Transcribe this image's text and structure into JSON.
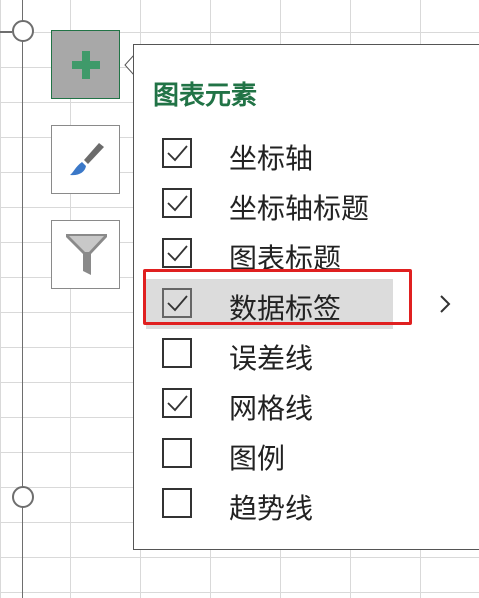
{
  "panel": {
    "title": "图表元素",
    "items": [
      {
        "label": "坐标轴",
        "checked": true
      },
      {
        "label": "坐标轴标题",
        "checked": true
      },
      {
        "label": "图表标题",
        "checked": true
      },
      {
        "label": "数据标签",
        "checked": true,
        "hovered": true,
        "has_submenu": true
      },
      {
        "label": "误差线",
        "checked": false
      },
      {
        "label": "网格线",
        "checked": true
      },
      {
        "label": "图例",
        "checked": false
      },
      {
        "label": "趋势线",
        "checked": false
      }
    ]
  },
  "side_buttons": [
    {
      "name": "chart-elements",
      "icon": "plus-icon",
      "active": true
    },
    {
      "name": "chart-styles",
      "icon": "paintbrush-icon",
      "active": false
    },
    {
      "name": "chart-filters",
      "icon": "funnel-icon",
      "active": false
    }
  ],
  "colors": {
    "accent": "#217346",
    "highlight": "#e02020",
    "hover": "#dcdcdc"
  }
}
